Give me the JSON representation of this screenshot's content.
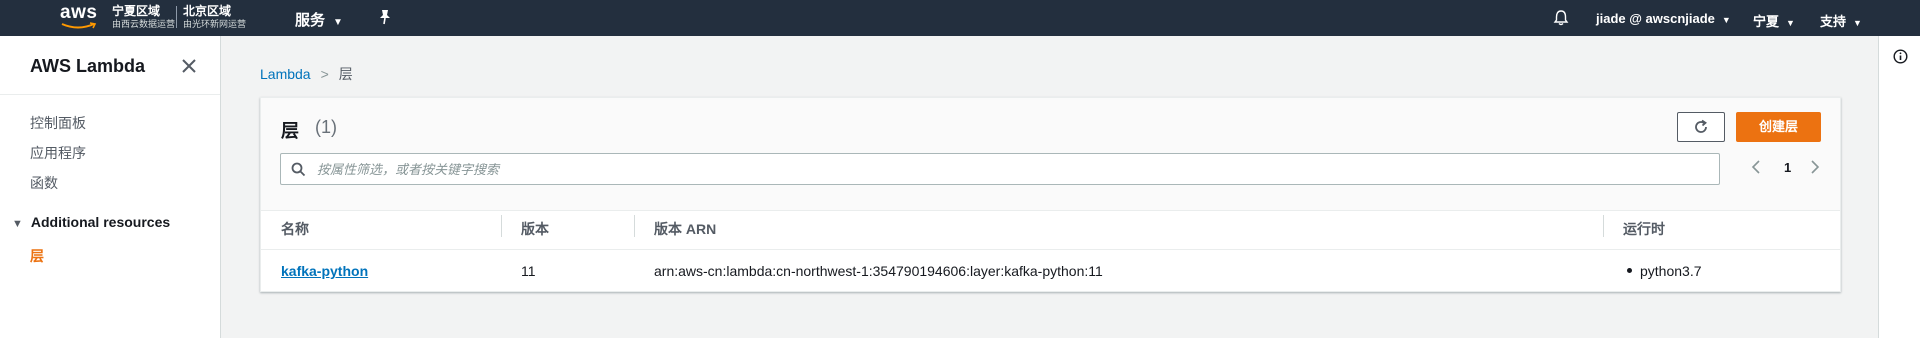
{
  "topnav": {
    "logo_text": "aws",
    "region1_name": "宁夏区域",
    "region1_operator": "由西云数据运营",
    "region2_name": "北京区域",
    "region2_operator": "由光环新网运营",
    "services_label": "服务",
    "user_label": "jiade @ awscnjiade",
    "region_label": "宁夏",
    "support_label": "支持"
  },
  "sidebar": {
    "title": "AWS Lambda",
    "items": [
      {
        "label": "控制面板"
      },
      {
        "label": "应用程序"
      },
      {
        "label": "函数"
      }
    ],
    "section_label": "Additional resources",
    "active_item": "层"
  },
  "breadcrumb": {
    "root": "Lambda",
    "current": "层"
  },
  "panel": {
    "title": "层",
    "count": "(1)",
    "create_label": "创建层",
    "search_placeholder": "按属性筛选，或者按关键字搜索",
    "page_number": "1",
    "columns": [
      "名称",
      "版本",
      "版本 ARN",
      "运行时"
    ],
    "rows": [
      {
        "name": "kafka-python",
        "version": "11",
        "arn": "arn:aws-cn:lambda:cn-northwest-1:354790194606:layer:kafka-python:11",
        "runtime": "python3.7"
      }
    ]
  },
  "colors": {
    "nav_bg": "#232f3e",
    "accent": "#ec7211",
    "link": "#0073bb"
  },
  "icons": [
    "aws-logo-icon",
    "chevron-down-icon",
    "pin-icon",
    "bell-icon",
    "close-icon",
    "triangle-down-icon",
    "refresh-icon",
    "search-icon",
    "chevron-left-icon",
    "chevron-right-icon",
    "info-icon"
  ]
}
